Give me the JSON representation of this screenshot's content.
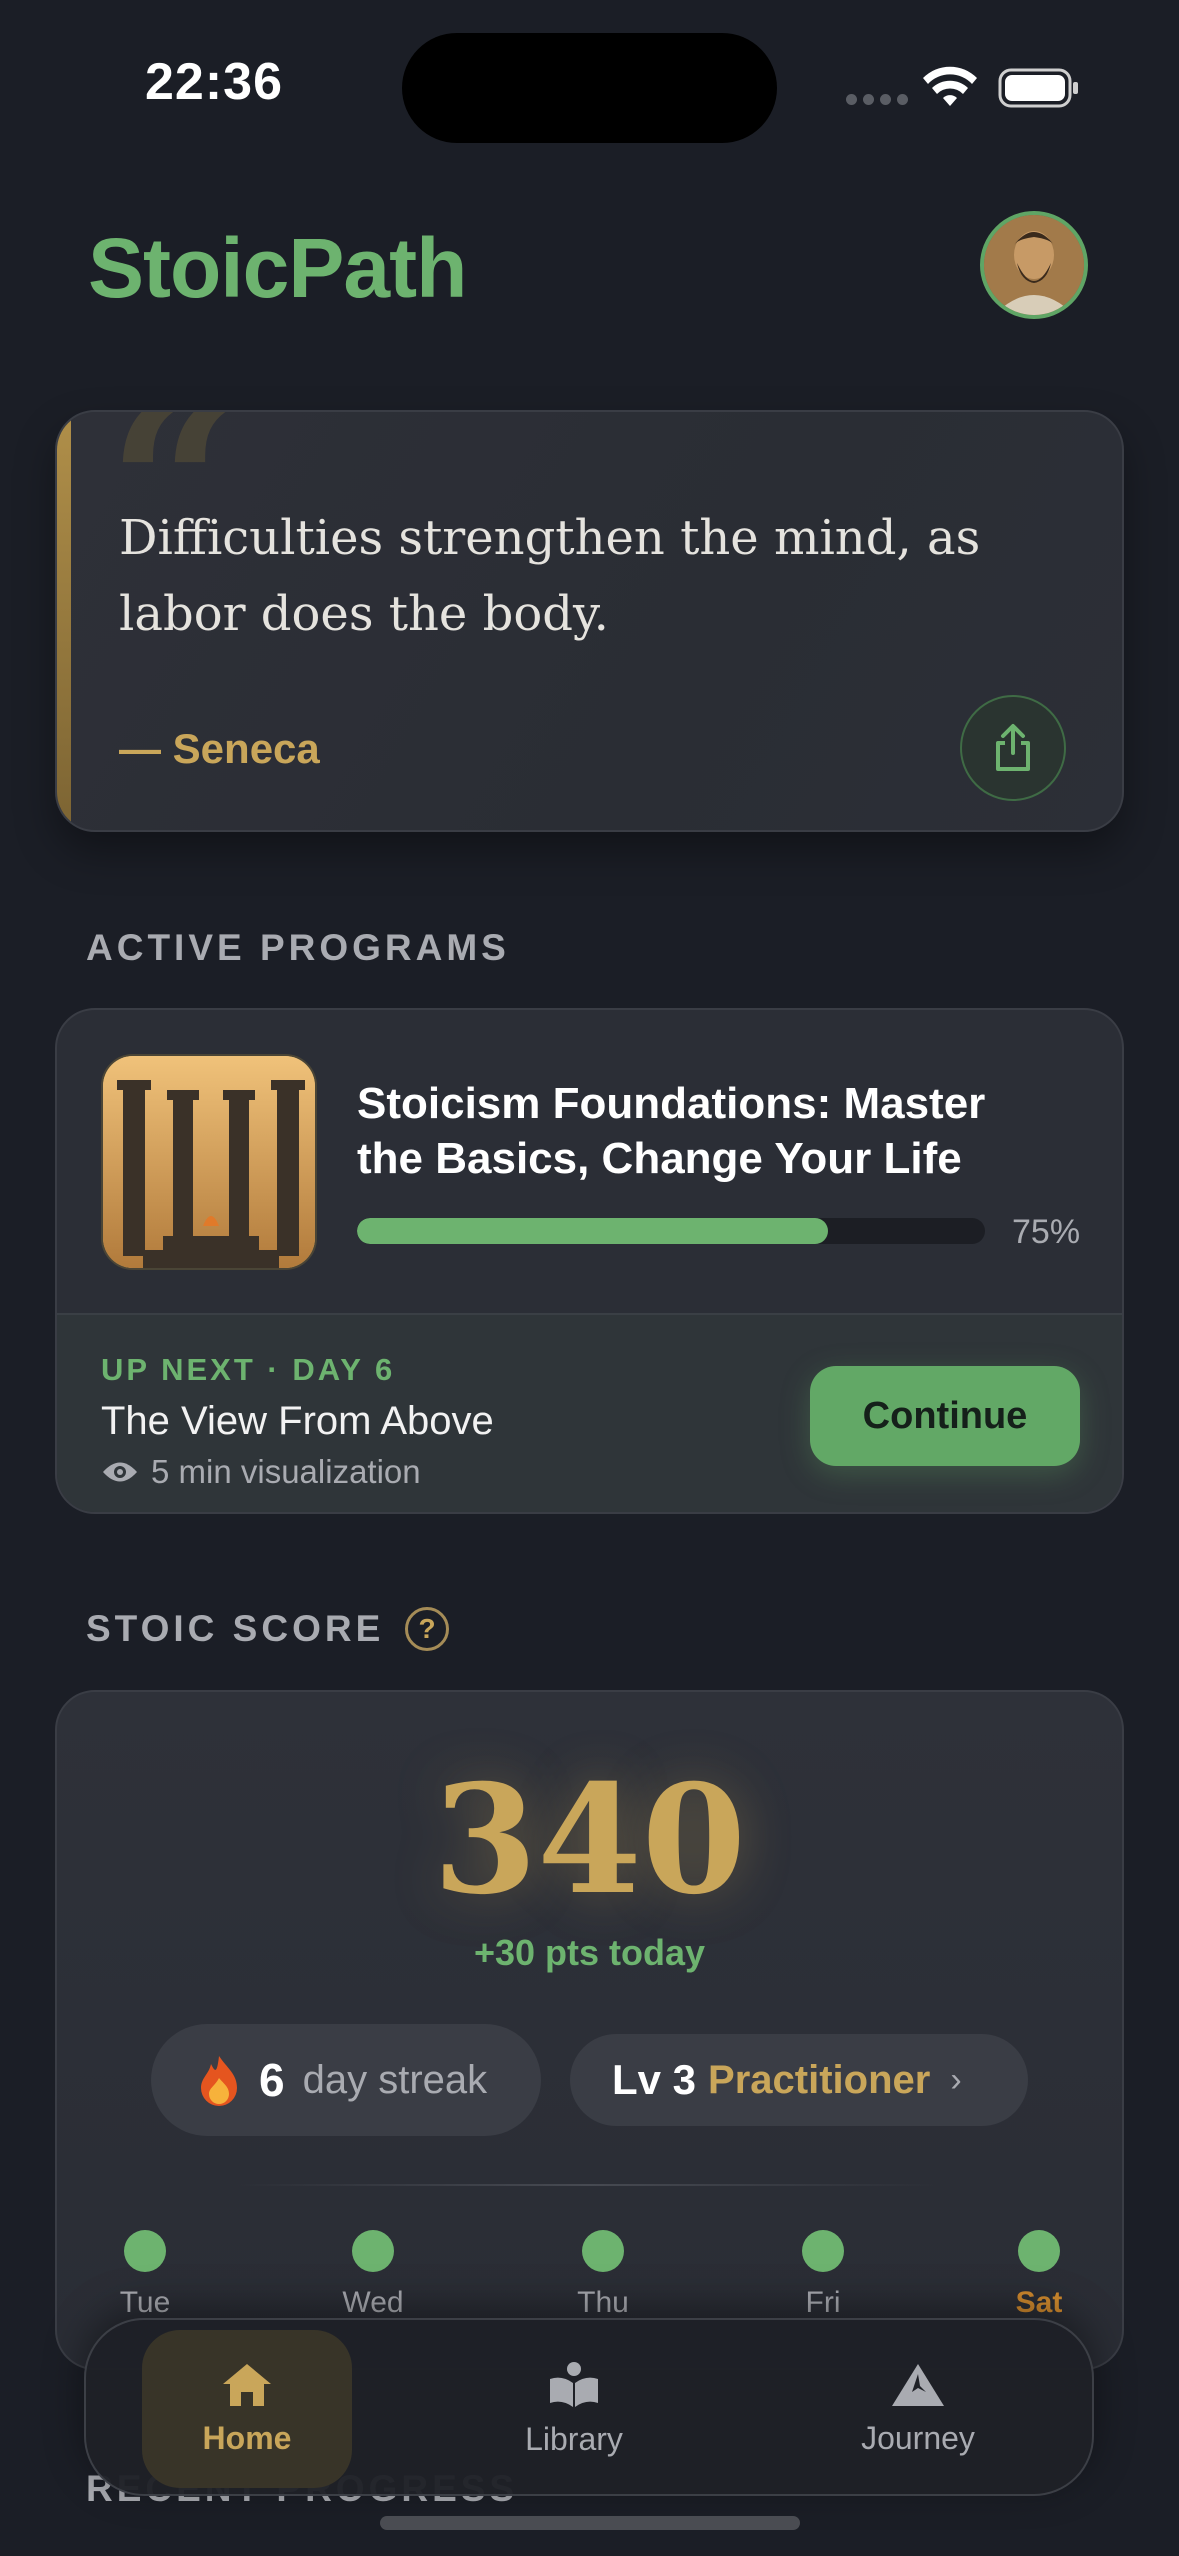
{
  "status_bar": {
    "time": "22:36"
  },
  "header": {
    "app_title": "StoicPath"
  },
  "quote": {
    "text": "Difficulties strengthen the mind, as labor does the body.",
    "author": "— Seneca"
  },
  "sections": {
    "active_programs": "ACTIVE PROGRAMS",
    "stoic_score": "STOIC SCORE",
    "recent_progress": "RECENT PROGRESS"
  },
  "program": {
    "title": "Stoicism Foundations: Master the Basics, Change Your Life",
    "progress_fraction": 0.75,
    "progress_label": "75%",
    "up_next_label": "UP NEXT · DAY 6",
    "up_next_title": "The View From Above",
    "up_next_meta": "5 min visualization",
    "continue_label": "Continue"
  },
  "score": {
    "value": "340",
    "delta": "+30 pts today",
    "streak_count": "6",
    "streak_text": "day streak",
    "level_num": "Lv 3",
    "level_name": "Practitioner",
    "help_symbol": "?"
  },
  "week": [
    {
      "label": "Tue",
      "done": true
    },
    {
      "label": "Wed",
      "done": true
    },
    {
      "label": "Thu",
      "done": true
    },
    {
      "label": "Fri",
      "done": true
    },
    {
      "label": "Sat",
      "done": true,
      "today": true
    }
  ],
  "tabs": [
    {
      "label": "Home",
      "active": true
    },
    {
      "label": "Library",
      "active": false
    },
    {
      "label": "Journey",
      "active": false
    }
  ],
  "colors": {
    "accent_green": "#6db36f",
    "accent_gold": "#c9a65a",
    "background": "#1b1e26",
    "today_orange": "#d18a2e"
  }
}
